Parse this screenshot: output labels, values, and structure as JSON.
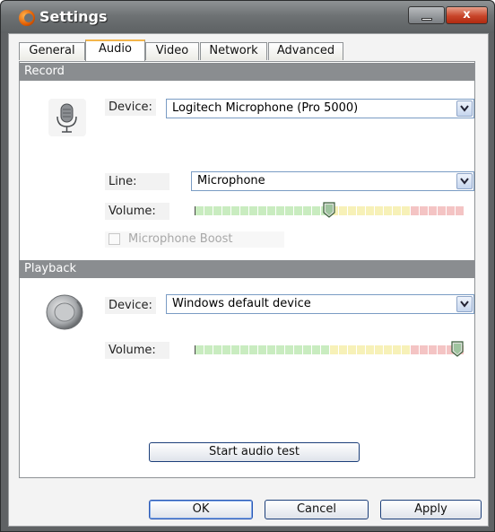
{
  "window": {
    "title": "Settings",
    "close_glyph": "x"
  },
  "tabs": [
    {
      "label": "General"
    },
    {
      "label": "Audio",
      "active": true
    },
    {
      "label": "Video"
    },
    {
      "label": "Network"
    },
    {
      "label": "Advanced"
    }
  ],
  "record": {
    "header": "Record",
    "icon": "microphone-icon",
    "device_label": "Device:",
    "device_value": "Logitech Microphone (Pro 5000)",
    "line_label": "Line:",
    "line_value": "Microphone",
    "volume_label": "Volume:",
    "volume_level": 0.5,
    "boost_label": "Microphone Boost",
    "boost_checked": false,
    "boost_enabled": false
  },
  "playback": {
    "header": "Playback",
    "icon": "speaker-icon",
    "device_label": "Device:",
    "device_value": "Windows default device",
    "volume_label": "Volume:",
    "volume_level": 1.0
  },
  "buttons": {
    "audio_test": "Start audio test",
    "ok": "OK",
    "cancel": "Cancel",
    "apply": "Apply"
  },
  "colors": {
    "meter_green": "#c9ecc0",
    "meter_yellow": "#f7f1b8",
    "meter_red": "#f4c4c4",
    "section_header": "#8a8d90",
    "active_tab_accent": "#f3b54b"
  }
}
